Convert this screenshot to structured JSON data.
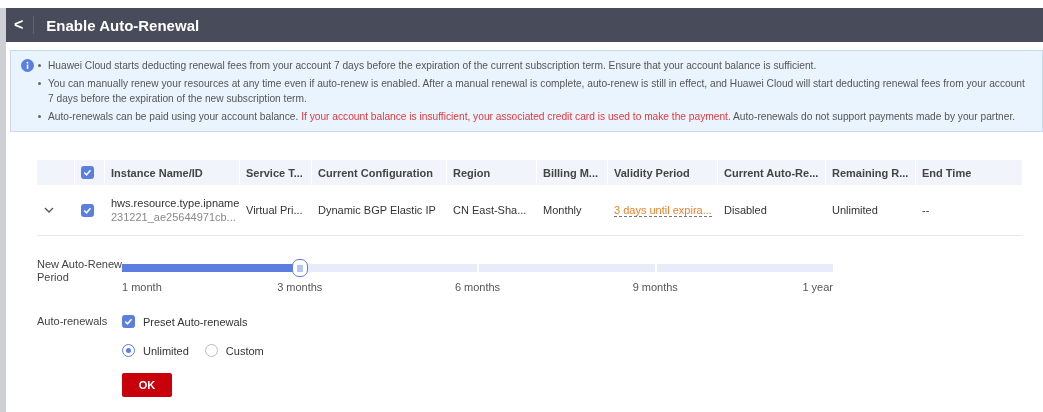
{
  "header": {
    "back": "<",
    "title": "Enable Auto-Renewal"
  },
  "notice": [
    {
      "segments": [
        {
          "text": "Huawei Cloud starts deducting renewal fees from your account 7 days before the expiration of the current subscription term. Ensure that your account balance is sufficient.",
          "highlight": false
        }
      ]
    },
    {
      "segments": [
        {
          "text": "You can manually renew your resources at any time even if auto-renew is enabled. After a manual renewal is complete, auto-renew is still in effect, and Huawei Cloud will start deducting renewal fees from your account 7 days before the expiration of the new subscription term.",
          "highlight": false
        }
      ]
    },
    {
      "segments": [
        {
          "text": "Auto-renewals can be paid using your account balance. ",
          "highlight": false
        },
        {
          "text": "If your account balance is insufficient, your associated credit card is used to make the payment.",
          "highlight": true
        },
        {
          "text": " Auto-renewals do not support payments made by your partner.",
          "highlight": false
        }
      ]
    }
  ],
  "table": {
    "select_all_checked": true,
    "columns": [
      "Instance Name/ID",
      "Service T...",
      "Current Configuration",
      "Region",
      "Billing M...",
      "Validity Period",
      "Current Auto-Re...",
      "Remaining R...",
      "End Time"
    ],
    "rows": [
      {
        "expanded": false,
        "checked": true,
        "name": "hws.resource.type.ipname",
        "id": "231221_ae25644971cb...",
        "service_type": "Virtual Pri...",
        "configuration": "Dynamic BGP Elastic IP",
        "region": "CN East-Sha...",
        "billing": "Monthly",
        "validity": "3 days until expira...",
        "auto_renew": "Disabled",
        "remaining": "Unlimited",
        "end_time": "--"
      }
    ]
  },
  "period": {
    "label": "New Auto-Renew Period",
    "level": 0.25,
    "ticks": [
      "1 month",
      "3 months",
      "6 months",
      "9 months",
      "1 year"
    ]
  },
  "auto_renewals": {
    "label": "Auto-renewals",
    "preset": {
      "label": "Preset Auto-renewals",
      "checked": true
    },
    "options": [
      {
        "label": "Unlimited",
        "selected": true
      },
      {
        "label": "Custom",
        "selected": false
      }
    ]
  },
  "ok_button": "OK"
}
